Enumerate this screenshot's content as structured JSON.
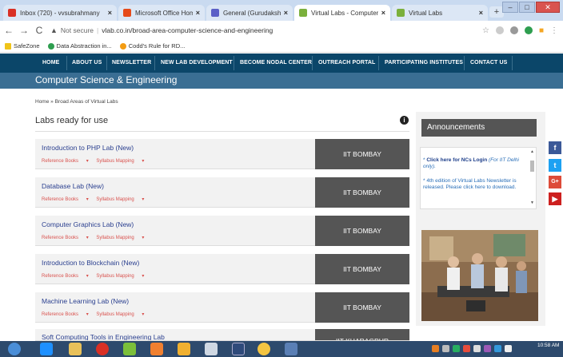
{
  "browser": {
    "tabs": [
      {
        "title": "Inbox (720) - vvsubrahmany",
        "active": false
      },
      {
        "title": "Microsoft Office Home",
        "active": false
      },
      {
        "title": "General (Gurudakshata Task",
        "active": false
      },
      {
        "title": "Virtual Labs - Computer Scie",
        "active": true
      },
      {
        "title": "Virtual Labs",
        "active": false
      }
    ],
    "url_security": "Not secure",
    "url": "vlab.co.in/broad-area-computer-science-and-engineering",
    "bookmarks": [
      "SafeZone",
      "Data Abstraction in...",
      "Codd's Rule for RD..."
    ]
  },
  "site": {
    "nav": [
      "HOME",
      "ABOUT US",
      "NEWSLETTER",
      "NEW LAB DEVELOPMENT",
      "BECOME NODAL CENTER",
      "OUTREACH PORTAL",
      "PARTICIPATING INSTITUTES",
      "CONTACT US"
    ],
    "title": "Computer Science & Engineering",
    "breadcrumb": "Home » Broad Areas of Virtual Labs"
  },
  "labs": {
    "heading": "Labs ready for use",
    "ref_label": "Reference Books",
    "syllabus_label": "Syllabus Mapping",
    "items": [
      {
        "name": "Introduction to PHP Lab (New)",
        "institute": "IIT BOMBAY"
      },
      {
        "name": "Database Lab (New)",
        "institute": "IIT BOMBAY"
      },
      {
        "name": "Computer Graphics Lab (New)",
        "institute": "IIT BOMBAY"
      },
      {
        "name": "Introduction to Blockchain (New)",
        "institute": "IIT BOMBAY"
      },
      {
        "name": "Machine Learning Lab (New)",
        "institute": "IIT BOMBAY"
      },
      {
        "name": "Soft Computing Tools in Engineering Lab",
        "institute": "IIT KHARAGPUR"
      }
    ]
  },
  "announcements": {
    "heading": "Announcements",
    "item1_bold": "Click here for NCs Login",
    "item1_italic": "(For IIT Delhi only).",
    "item2": "4th edition of Virtual Labs Newsletter is released. Please click here to download."
  },
  "social": [
    "f",
    "t",
    "G+",
    "yt"
  ],
  "taskbar": {
    "time": "10:58 AM"
  },
  "colors": {
    "nav_bg": "#0b4669",
    "header_bg": "#3a6e93",
    "lab_link": "#2a3f8f",
    "ref_link": "#d9534f",
    "institute_bg": "#555555"
  }
}
